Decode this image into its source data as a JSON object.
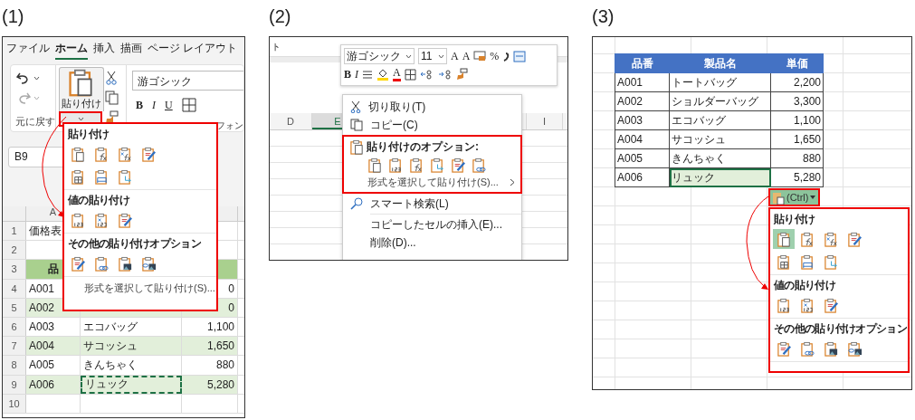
{
  "panel_1": {
    "caption": "(1)",
    "tabs": [
      {
        "label": "ファイル",
        "selected": false
      },
      {
        "label": "ホーム",
        "selected": true
      },
      {
        "label": "挿入",
        "selected": false
      },
      {
        "label": "描画",
        "selected": false
      },
      {
        "label": "ページ レイアウト",
        "selected": false
      }
    ],
    "undo_group_label": "元に戻す",
    "paste_button": "貼り付け",
    "font_field": "游ゴシック",
    "format_buttons": [
      "B",
      "I",
      "U"
    ],
    "font_group_label": "フォン",
    "name_box": "B9",
    "column_header": "A",
    "rows": [
      {
        "number": "1",
        "kind": "plain",
        "a": "価格表"
      },
      {
        "number": "2",
        "kind": "plain"
      },
      {
        "number": "3",
        "kind": "header",
        "a": "品"
      },
      {
        "number": "4",
        "kind": "plain",
        "a": "A001",
        "c": "0"
      },
      {
        "number": "5",
        "kind": "banded",
        "a": "A002",
        "c": "0"
      },
      {
        "number": "6",
        "kind": "plain",
        "a": "A003",
        "b": {
          "text": "エコバッグ",
          "copied": false
        },
        "c": "1,100"
      },
      {
        "number": "7",
        "kind": "banded",
        "a": "A004",
        "b": {
          "text": "サコッシュ",
          "copied": false
        },
        "c": "1,650"
      },
      {
        "number": "8",
        "kind": "plain",
        "a": "A005",
        "b": {
          "text": "きんちゃく",
          "copied": false
        },
        "c": "880"
      },
      {
        "number": "9",
        "kind": "banded",
        "a": "A006",
        "b": {
          "text": "リュック",
          "copied": true
        },
        "c": "5,280"
      },
      {
        "number": "10",
        "kind": "plain"
      }
    ],
    "paste_menu": {
      "sections": [
        {
          "title": "貼り付け",
          "icons": [
            {
              "kind": "all"
            },
            {
              "kind": "formula"
            },
            {
              "kind": "formula-number"
            },
            {
              "kind": "keep-format"
            },
            {
              "kind": "no-borders"
            },
            {
              "kind": "column-width"
            },
            {
              "kind": "transpose"
            }
          ]
        },
        {
          "title": "値の貼り付け",
          "icons": [
            {
              "kind": "values"
            },
            {
              "kind": "values-number"
            },
            {
              "kind": "values-format"
            }
          ]
        },
        {
          "title": "その他の貼り付けオプション",
          "icons": [
            {
              "kind": "formatting"
            },
            {
              "kind": "link"
            },
            {
              "kind": "picture"
            },
            {
              "kind": "linked-picture"
            }
          ]
        }
      ],
      "footer": "形式を選択して貼り付け(S)..."
    }
  },
  "panel_2": {
    "caption": "(2)",
    "sheet_text": "ト",
    "columns": [
      {
        "label": "D",
        "selected": false
      },
      {
        "label": "E",
        "selected": true
      },
      {
        "label": "I",
        "selected": false
      }
    ],
    "mini_toolbar": {
      "font": "游ゴシック",
      "size": "11",
      "grow": "A",
      "shrink": "A",
      "percent": "%",
      "bold": "B",
      "italic": "I",
      "font_color": "A"
    },
    "context_menu": {
      "items_before": [
        {
          "label": "切り取り(T)"
        },
        {
          "label": "コピー(C)"
        }
      ],
      "paste_options": {
        "title": "貼り付けのオプション:",
        "icons": [
          {
            "kind": "all"
          },
          {
            "kind": "values"
          },
          {
            "kind": "formula"
          },
          {
            "kind": "transpose"
          },
          {
            "kind": "formatting"
          },
          {
            "kind": "link"
          }
        ],
        "special": "形式を選択して貼り付け(S)..."
      },
      "items_after": [
        {
          "label": "スマート検索(L)"
        },
        {
          "label": "コピーしたセルの挿入(E)..."
        },
        {
          "label": "削除(D)..."
        }
      ]
    }
  },
  "panel_3": {
    "caption": "(3)",
    "table": {
      "columns": [
        "品番",
        "製品名",
        "単価"
      ],
      "rows": [
        {
          "cells": [
            "A001",
            "トートバッグ",
            "2,200"
          ],
          "selected": false
        },
        {
          "cells": [
            "A002",
            "ショルダーバッグ",
            "3,300"
          ],
          "selected": false
        },
        {
          "cells": [
            "A003",
            "エコバッグ",
            "1,100"
          ],
          "selected": false
        },
        {
          "cells": [
            "A004",
            "サコッシュ",
            "1,650"
          ],
          "selected": false
        },
        {
          "cells": [
            "A005",
            "きんちゃく",
            "880"
          ],
          "selected": false
        },
        {
          "cells": [
            "A006",
            "リュック",
            "5,280"
          ],
          "selected": true
        }
      ]
    },
    "paste_button": "(Ctrl)",
    "paste_menu": {
      "sections": [
        {
          "title": "貼り付け",
          "icons": [
            {
              "kind": "all",
              "selected": true
            },
            {
              "kind": "formula",
              "selected": false
            },
            {
              "kind": "formula-number",
              "selected": false
            },
            {
              "kind": "keep-format",
              "selected": false
            },
            {
              "kind": "no-borders",
              "selected": false
            },
            {
              "kind": "column-width",
              "selected": false
            },
            {
              "kind": "transpose",
              "selected": false
            }
          ]
        },
        {
          "title": "値の貼り付け",
          "icons": [
            {
              "kind": "values",
              "selected": false
            },
            {
              "kind": "values-number",
              "selected": false
            },
            {
              "kind": "values-format",
              "selected": false
            }
          ]
        },
        {
          "title": "その他の貼り付けオプション",
          "icons": [
            {
              "kind": "formatting",
              "selected": false
            },
            {
              "kind": "link",
              "selected": false
            },
            {
              "kind": "picture",
              "selected": false
            },
            {
              "kind": "linked-picture",
              "selected": false
            }
          ]
        }
      ]
    }
  }
}
